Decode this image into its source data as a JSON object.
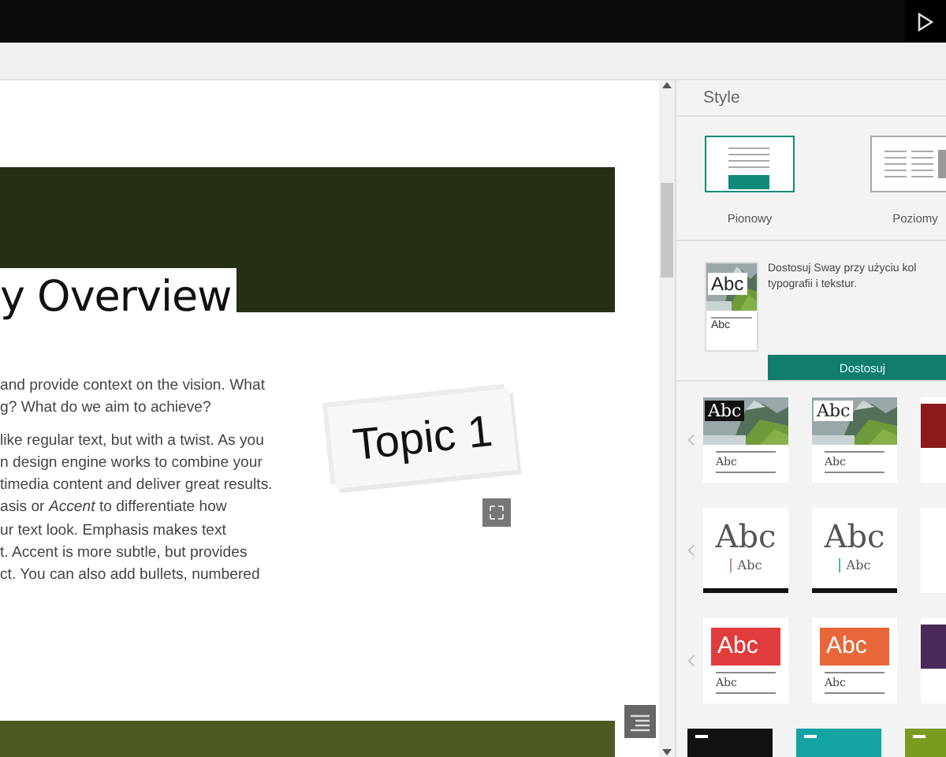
{
  "canvas": {
    "heading": "y Overview",
    "paragraphs": [
      "and provide context on the vision. What\ng? What do we aim to achieve?",
      "like regular text, but with a twist. As you\nn design engine works to combine your\ntimedia content and deliver great results.\nasis or *Accent* to differentiate how\nur text look. Emphasis makes text\nt. Accent is more subtle, but provides\nct. You can also add bullets, numbered"
    ],
    "card_text": "Topic 1"
  },
  "panel": {
    "title": "Style",
    "layouts": [
      {
        "label": "Pionowy",
        "kind": "vertical",
        "selected": true
      },
      {
        "label": "Poziomy",
        "kind": "horizontal",
        "selected": false
      }
    ],
    "customize": {
      "text": "Dostosuj Sway przy użyciu kol\ntypografii i tekstur.",
      "thumb_title": "Abc",
      "thumb_sub": "Abc",
      "button": "Dostosuj"
    },
    "theme_rows": [
      {
        "cards": [
          {
            "kind": "photo-dark",
            "title": "Abc",
            "sub": "Abc"
          },
          {
            "kind": "photo-light",
            "title": "Abc",
            "sub": "Abc"
          },
          {
            "kind": "sliver",
            "color": "#8b1a1a"
          }
        ]
      },
      {
        "cards": [
          {
            "kind": "serif",
            "title": "Abc",
            "sub": "Abc",
            "color": "#c8908a"
          },
          {
            "kind": "serif",
            "title": "Abc",
            "sub": "Abc",
            "color": "#5bb0b0"
          },
          {
            "kind": "sliver",
            "color": "#ffffff"
          }
        ]
      },
      {
        "cards": [
          {
            "kind": "block",
            "title": "Abc",
            "sub": "Abc",
            "color": "#e03c3c"
          },
          {
            "kind": "block",
            "title": "Abc",
            "sub": "Abc",
            "color": "#e8673a"
          },
          {
            "kind": "sliver",
            "color": "#4a2a5a"
          }
        ]
      },
      {
        "cards": [
          {
            "kind": "top",
            "color": "#111111"
          },
          {
            "kind": "top",
            "color": "#14a3a3"
          },
          {
            "kind": "top",
            "color": "#7a9a20"
          }
        ]
      }
    ]
  }
}
